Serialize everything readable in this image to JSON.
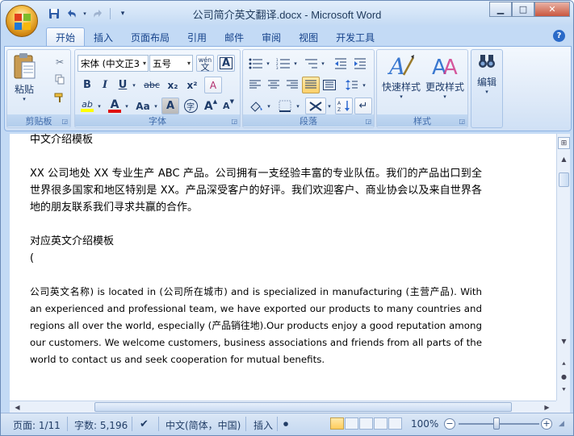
{
  "window": {
    "title": "公司简介英文翻译.docx - Microsoft Word"
  },
  "quick_access": {
    "save_icon": "save-icon",
    "undo_icon": "undo-icon",
    "redo_icon": "redo-icon"
  },
  "window_controls": {
    "minimize": "▁",
    "maximize": "□",
    "close": "✕"
  },
  "tabs": [
    {
      "label": "开始",
      "active": true
    },
    {
      "label": "插入"
    },
    {
      "label": "页面布局"
    },
    {
      "label": "引用"
    },
    {
      "label": "邮件"
    },
    {
      "label": "审阅"
    },
    {
      "label": "视图"
    },
    {
      "label": "开发工具"
    }
  ],
  "ribbon": {
    "clipboard": {
      "label": "剪贴板",
      "paste_label": "粘贴"
    },
    "font": {
      "label": "字体",
      "font_name": "宋体 (中文正3",
      "font_size": "五号",
      "bold": "B",
      "italic": "I",
      "underline": "U",
      "strike": "abc",
      "subscript": "x₂",
      "superscript": "x²",
      "change_case": "Aa",
      "grow": "A",
      "shrink": "A",
      "clear": "A",
      "char_border": "A",
      "enclosed": "字",
      "phonetic": "wén",
      "phonetic_char": "文",
      "highlight": "ab",
      "font_color": "A"
    },
    "paragraph": {
      "label": "段落"
    },
    "styles": {
      "label": "样式",
      "quick_styles": "快速样式",
      "change_styles": "更改样式"
    },
    "editing": {
      "label": "编辑"
    }
  },
  "document": {
    "line1": "中文介绍模板",
    "para1": "XX 公司地处 XX 专业生产 ABC 产品。公司拥有一支经验丰富的专业队伍。我们的产品出口到全世界很多国家和地区特别是  XX。产品深受客户的好评。我们欢迎客户、商业协会以及来自世界各地的朋友联系我们寻求共赢的合作。",
    "line2": "对应英文介绍模板",
    "line3": "(",
    "para2": "公司英文名称) is located in (公司所在城市) and is specialized in manufacturing (主营产品). With an experienced and professional team, we have exported our products to many countries and regions all over the world, especially   (产品销往地).Our products enjoy a good reputation among our customers. We welcome customers, business associations and friends from all parts of the world to contact us and seek cooperation for mutual benefits."
  },
  "status": {
    "page": "页面: 1/11",
    "words": "字数: 5,196",
    "language": "中文(简体，中国)",
    "mode": "插入",
    "zoom": "100%",
    "zoom_minus": "−",
    "zoom_plus": "+"
  }
}
